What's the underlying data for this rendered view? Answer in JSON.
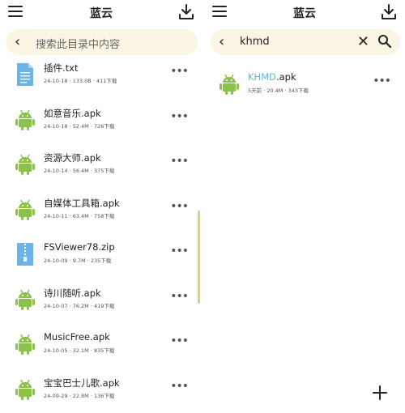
{
  "left": {
    "title": "蓝云",
    "search_placeholder": "搜索此目录中内容",
    "files": [
      {
        "name": "插件.txt",
        "meta": "24-10-18 · 133.0B · 411下载",
        "icon": "text-file-icon"
      },
      {
        "name": "如意音乐.apk",
        "meta": "24-10-18 · 52.4M · 726下载",
        "icon": "android-icon"
      },
      {
        "name": "资源大师.apk",
        "meta": "24-10-14 · 56.4M · 375下载",
        "icon": "android-icon"
      },
      {
        "name": "自媒体工具箱.apk",
        "meta": "24-10-11 · 63.4M · 758下载",
        "icon": "android-icon"
      },
      {
        "name": "FSViewer78.zip",
        "meta": "24-10-09 · 9.7M · 235下载",
        "icon": "zip-file-icon"
      },
      {
        "name": "诗川随听.apk",
        "meta": "24-10-07 · 76.2M · 419下载",
        "icon": "android-icon"
      },
      {
        "name": "MusicFree.apk",
        "meta": "24-10-05 · 32.1M · 835下载",
        "icon": "android-icon"
      },
      {
        "name": "宝宝巴士儿歌.apk",
        "meta": "24-09-29 · 22.8M · 136下载",
        "icon": "android-icon"
      }
    ]
  },
  "right": {
    "title": "蓝云",
    "search_query": "khmd",
    "results": [
      {
        "name_highlight": "KHMD",
        "name_rest": ".apk",
        "meta": "5天前 · 20.4M · 343下载",
        "icon": "android-icon"
      }
    ]
  },
  "colors": {
    "android_green": "#8bc34a",
    "search_bg": "#fbf6e3",
    "highlight": "#5fb8d6",
    "file_blue": "#6cb4e8"
  }
}
